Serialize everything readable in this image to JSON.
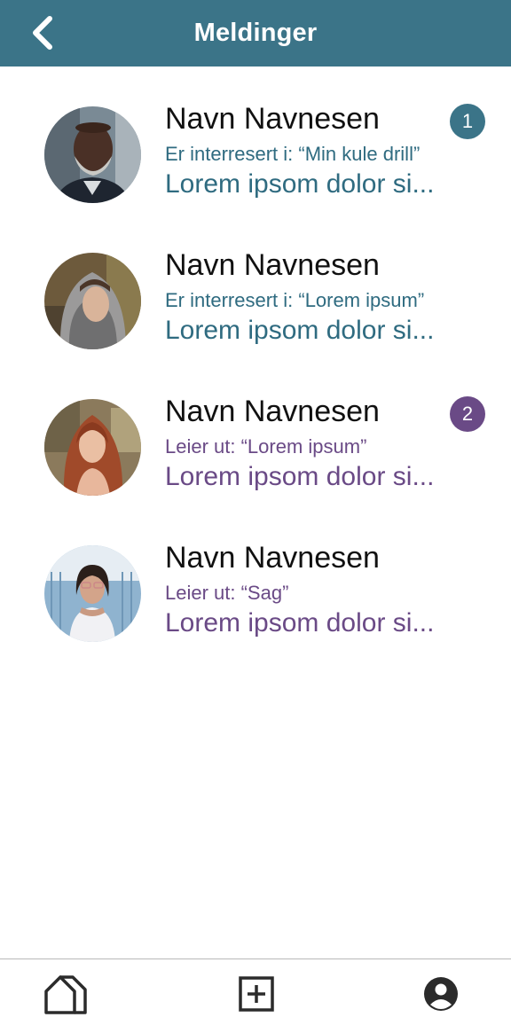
{
  "header": {
    "title": "Meldinger",
    "back_icon": "chevron-left-icon"
  },
  "messages": [
    {
      "name": "Navn Navnesen",
      "context": "Er interresert i: “Min kule drill”",
      "preview": "Lorem ipsom dolor si...",
      "badge": "1",
      "accent": "#3b7488"
    },
    {
      "name": "Navn Navnesen",
      "context": "Er interresert i: “Lorem ipsum”",
      "preview": "Lorem ipsom dolor si...",
      "badge": "",
      "accent": "#3b7488"
    },
    {
      "name": "Navn Navnesen",
      "context": "Leier ut: “Lorem ipsum”",
      "preview": "Lorem ipsom dolor si...",
      "badge": "2",
      "accent": "#6a4a86"
    },
    {
      "name": "Navn Navnesen",
      "context": "Leier ut: “Sag”",
      "preview": "Lorem ipsom dolor si...",
      "badge": "",
      "accent": "#6a4a86"
    }
  ],
  "bottom_nav": {
    "items": [
      {
        "icon": "home-icon"
      },
      {
        "icon": "add-box-icon"
      },
      {
        "icon": "account-circle-icon"
      }
    ]
  },
  "colors": {
    "header_bg": "#3b7488",
    "teal_text": "#2f6b80",
    "purple_text": "#6a4a86"
  }
}
